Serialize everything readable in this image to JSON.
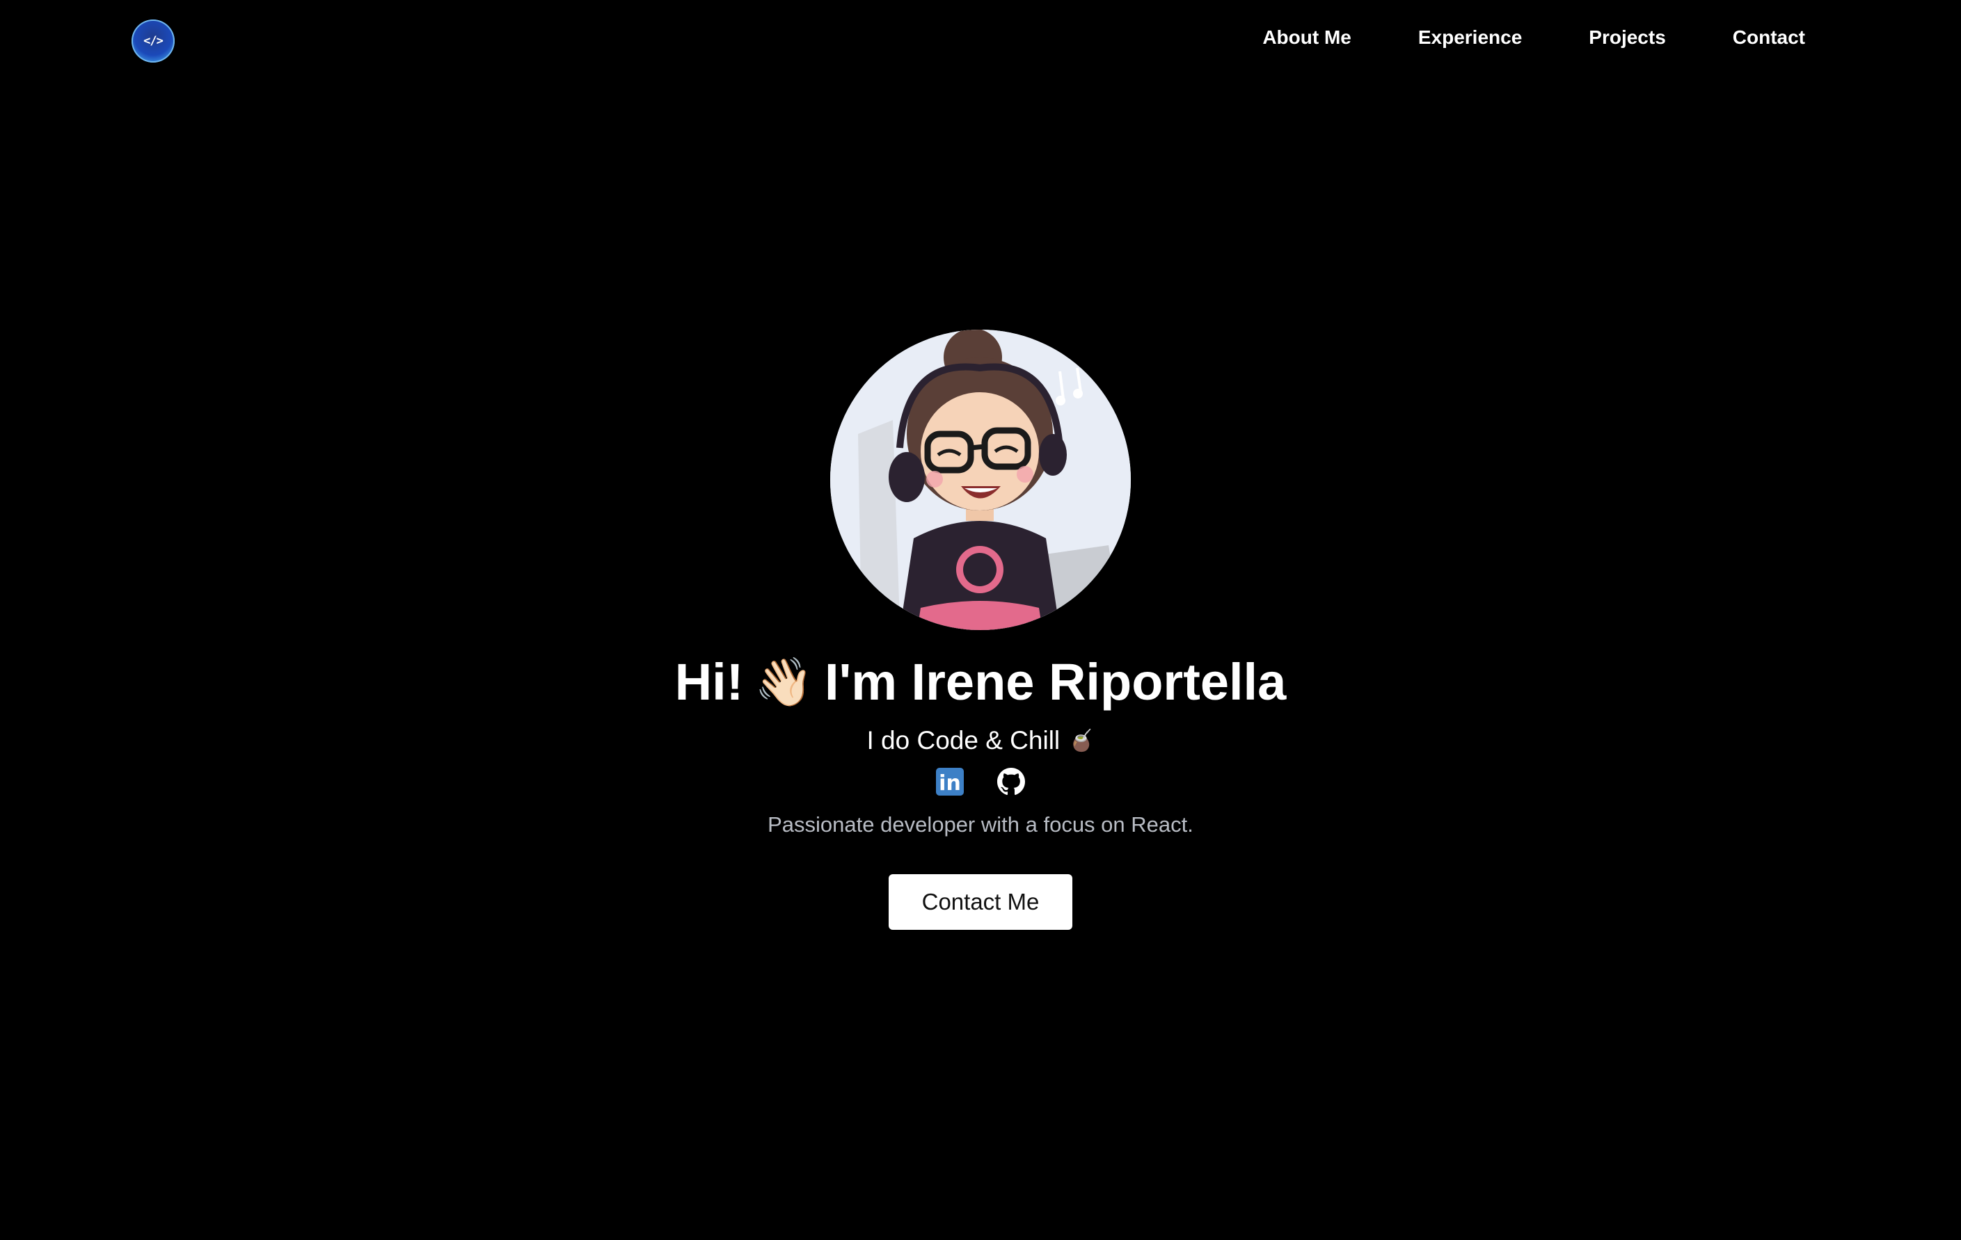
{
  "header": {
    "logo_text": "</>",
    "nav": [
      "About Me",
      "Experience",
      "Projects",
      "Contact"
    ]
  },
  "hero": {
    "greeting_start": "Hi!",
    "wave_emoji": "👋🏻",
    "greeting_name": "I'm Irene Riportella",
    "tagline": "I do Code & Chill",
    "tagline_emoji": "🧉",
    "description": "Passionate developer with a focus on React.",
    "cta_label": "Contact Me",
    "socials": [
      {
        "name": "linkedin-icon",
        "glyph": "in"
      },
      {
        "name": "github-icon"
      }
    ]
  },
  "colors": {
    "background": "#000000",
    "text": "#ffffff",
    "muted_text": "#b8bcc4",
    "linkedin": "#3d80c6",
    "logo": "#1b49b9"
  }
}
